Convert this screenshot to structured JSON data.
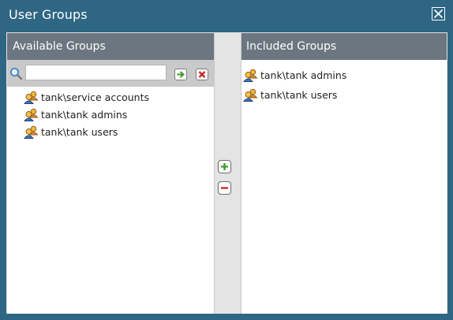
{
  "dialog": {
    "title": "User Groups",
    "close_icon": "close-icon"
  },
  "available": {
    "header": "Available Groups",
    "search": {
      "value": "",
      "placeholder": ""
    },
    "go_icon": "arrow-right-icon",
    "clear_icon": "clear-x-icon",
    "items": [
      {
        "label": "tank\\service accounts",
        "icon": "user-group-icon"
      },
      {
        "label": "tank\\tank admins",
        "icon": "user-group-icon"
      },
      {
        "label": "tank\\tank users",
        "icon": "user-group-icon"
      }
    ]
  },
  "included": {
    "header": "Included Groups",
    "items": [
      {
        "label": "tank\\tank admins",
        "icon": "user-group-icon"
      },
      {
        "label": "tank\\tank users",
        "icon": "user-group-icon"
      }
    ]
  },
  "transfer": {
    "add_icon": "plus-icon",
    "remove_icon": "minus-icon"
  },
  "colors": {
    "frame": "#2e6683",
    "panel_header": "#6b7680",
    "filter_bar": "#c9c9c9",
    "divider": "#e4e4e4",
    "go_green": "#3d9a2a",
    "clear_red": "#c8231b"
  }
}
